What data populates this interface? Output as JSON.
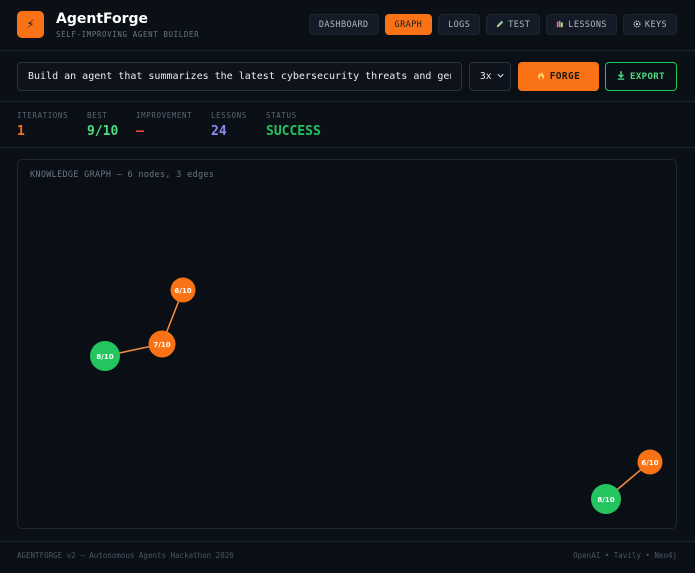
{
  "header": {
    "logo_glyph": "⚡",
    "title": "AgentForge",
    "subtitle": "SELF-IMPROVING AGENT BUILDER",
    "nav": [
      {
        "label": "DASHBOARD",
        "icon": "",
        "active": false
      },
      {
        "label": "GRAPH",
        "icon": "",
        "active": true
      },
      {
        "label": "LOGS",
        "icon": "",
        "active": false
      },
      {
        "label": "TEST",
        "icon": "pencil-icon",
        "active": false
      },
      {
        "label": "LESSONS",
        "icon": "books-icon",
        "active": false
      },
      {
        "label": "KEYS",
        "icon": "gear-icon",
        "active": false
      }
    ]
  },
  "prompt": {
    "value": "Build an agent that summarizes the latest cybersecurity threats and gener",
    "iterations_selected": "3x",
    "forge_label": "FORGE",
    "forge_icon": "fire-icon",
    "export_label": "EXPORT",
    "export_icon": "download-icon"
  },
  "stats": [
    {
      "label": "ITERATIONS",
      "value": "1",
      "color": "#f97316"
    },
    {
      "label": "BEST",
      "value": "9/10",
      "color": "#4ade80"
    },
    {
      "label": "IMPROVEMENT",
      "value": "—",
      "color": "#ef4444"
    },
    {
      "label": "LESSONS",
      "value": "24",
      "color": "#8b8cf8"
    },
    {
      "label": "STATUS",
      "value": "SUCCESS",
      "color": "#22c55e"
    }
  ],
  "graph": {
    "title": "KNOWLEDGE GRAPH — 6 nodes, 3 edges",
    "colors": {
      "orange": "#f97316",
      "green": "#22c55e",
      "edge": "#f08a3c"
    },
    "nodes": [
      {
        "label": "6/10",
        "color": "orange"
      },
      {
        "label": "7/10",
        "color": "orange"
      },
      {
        "label": "8/10",
        "color": "green"
      },
      {
        "label": "6/10",
        "color": "orange"
      },
      {
        "label": "8/10",
        "color": "green"
      }
    ]
  },
  "footer": {
    "left": "AGENTFORGE v2 — Autonomous Agents Hackathon 2026",
    "right": "OpenAI • Tavily • Neo4j"
  }
}
